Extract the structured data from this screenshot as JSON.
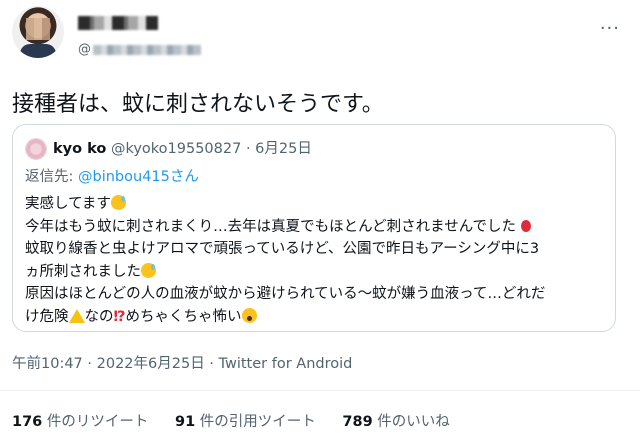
{
  "tweet": {
    "handle_prefix": "@",
    "text": "接種者は、蚊に刺されないそうです。",
    "more_icon": "more-dots-icon"
  },
  "quote": {
    "name": "kyo ko",
    "handle": "@kyoko19550827",
    "separator": "·",
    "date": "6月25日",
    "reply_prefix": "返信先: ",
    "reply_mention": "@binbou415さん",
    "lines": [
      "実感してます",
      "今年はもう蚊に刺されまくり…去年は真夏でもほとんど刺されませんでした",
      "蚊取り線香と虫よけアロマで頑張っているけど、公園で昨日もアーシング中に3",
      "ヵ所刺されました",
      "原因はほとんどの人の血液が蚊から避けられている〜蚊が嫌う血液って…どれだ",
      "け危険",
      "なの",
      "めちゃくちゃ怖い"
    ]
  },
  "timestamp": "午前10:47 · 2022年6月25日 · Twitter for Android",
  "stats": {
    "retweets_count": "176",
    "retweets_label": " 件のリツイート",
    "quotes_count": "91",
    "quotes_label": " 件の引用ツイート",
    "likes_count": "789",
    "likes_label": " 件のいいね"
  }
}
